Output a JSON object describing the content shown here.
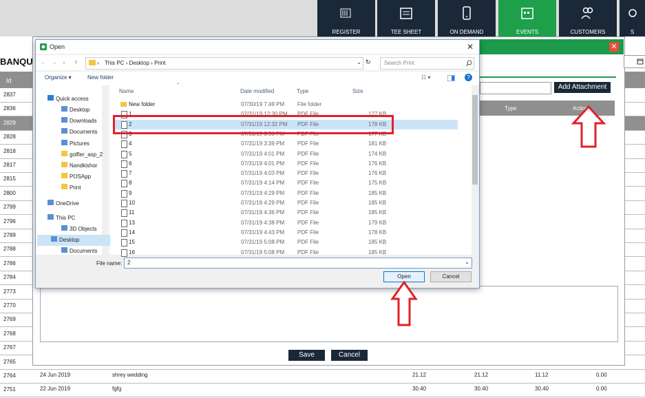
{
  "nav": [
    {
      "label": "REGISTER",
      "icon": "barcode-scanner-icon"
    },
    {
      "label": "TEE SHEET",
      "icon": "calendar-icon"
    },
    {
      "label": "ON DEMAND",
      "icon": "mobile-icon"
    },
    {
      "label": "EVENTS",
      "icon": "events-calendar-icon"
    },
    {
      "label": "CUSTOMERS",
      "icon": "users-icon"
    },
    {
      "label": "S",
      "icon": "settings-icon"
    }
  ],
  "page": {
    "title": "BANQUE",
    "id_header": "Id",
    "row_ids": [
      "2837",
      "2836",
      "2829",
      "2828",
      "2818",
      "2817",
      "2815",
      "2800",
      "2799",
      "2796",
      "2789",
      "2788",
      "2786",
      "2784",
      "2773",
      "2770",
      "2769",
      "2768",
      "2767",
      "2765",
      "2764",
      "2751"
    ],
    "selected_id": "2829",
    "bottom_rows": [
      {
        "id": "2764",
        "date": "24 Jun 2019",
        "name": "shrey wedding",
        "v1": "21.12",
        "v2": "21.12",
        "v3": "11.12",
        "v4": "0.00"
      },
      {
        "id": "2751",
        "date": "22 Jun 2019",
        "name": "fgfg",
        "v1": "30.40",
        "v2": "30.40",
        "v3": "30.40",
        "v4": "0.00"
      }
    ]
  },
  "modal": {
    "add_attachment": "Add Attachment",
    "type_header": "Type",
    "action_header": "Action",
    "save": "Save",
    "cancel": "Cancel",
    "close": "✕"
  },
  "dialog": {
    "title": "Open",
    "path": [
      "This PC",
      "Desktop",
      "Print"
    ],
    "search_placeholder": "Search Print",
    "organize": "Organize ▾",
    "new_folder": "New folder",
    "nav_items": [
      {
        "label": "Quick access",
        "icon": "star-icon"
      },
      {
        "label": "Desktop",
        "icon": "desktop-icon"
      },
      {
        "label": "Downloads",
        "icon": "download-icon"
      },
      {
        "label": "Documents",
        "icon": "document-icon"
      },
      {
        "label": "Pictures",
        "icon": "pictures-icon"
      },
      {
        "label": "golfler_asp_2",
        "icon": "folder-icon"
      },
      {
        "label": "Nandkishor",
        "icon": "folder-icon"
      },
      {
        "label": "POSApp",
        "icon": "folder-icon"
      },
      {
        "label": "Print",
        "icon": "folder-icon"
      },
      {
        "label": "OneDrive",
        "icon": "cloud-icon"
      },
      {
        "label": "This PC",
        "icon": "computer-icon"
      },
      {
        "label": "3D Objects",
        "icon": "cube-icon"
      },
      {
        "label": "Desktop",
        "icon": "desktop-icon"
      },
      {
        "label": "Documents",
        "icon": "document-icon"
      }
    ],
    "columns": [
      "Name",
      "Date modified",
      "Type",
      "Size"
    ],
    "files": [
      {
        "name": "New folder",
        "date": "07/30/19 7:49 PM",
        "type": "File folder",
        "size": ""
      },
      {
        "name": "1",
        "date": "07/31/19 12:30 PM",
        "type": "PDF File",
        "size": "177 KB"
      },
      {
        "name": "2",
        "date": "07/31/19 12:32 PM",
        "type": "PDF File",
        "size": "178 KB"
      },
      {
        "name": "3",
        "date": "07/31/19 3:50 PM",
        "type": "PDF File",
        "size": "177 KB"
      },
      {
        "name": "4",
        "date": "07/31/19 3:39 PM",
        "type": "PDF File",
        "size": "181 KB"
      },
      {
        "name": "5",
        "date": "07/31/19 4:01 PM",
        "type": "PDF File",
        "size": "174 KB"
      },
      {
        "name": "6",
        "date": "07/31/19 4:01 PM",
        "type": "PDF File",
        "size": "176 KB"
      },
      {
        "name": "7",
        "date": "07/31/19 4:03 PM",
        "type": "PDF File",
        "size": "176 KB"
      },
      {
        "name": "8",
        "date": "07/31/19 4:14 PM",
        "type": "PDF File",
        "size": "175 KB"
      },
      {
        "name": "9",
        "date": "07/31/19 4:29 PM",
        "type": "PDF File",
        "size": "185 KB"
      },
      {
        "name": "10",
        "date": "07/31/19 4:29 PM",
        "type": "PDF File",
        "size": "185 KB"
      },
      {
        "name": "11",
        "date": "07/31/19 4:36 PM",
        "type": "PDF File",
        "size": "185 KB"
      },
      {
        "name": "13",
        "date": "07/31/19 4:38 PM",
        "type": "PDF File",
        "size": "179 KB"
      },
      {
        "name": "14",
        "date": "07/31/19 4:43 PM",
        "type": "PDF File",
        "size": "178 KB"
      },
      {
        "name": "15",
        "date": "07/31/19 5:08 PM",
        "type": "PDF File",
        "size": "185 KB"
      },
      {
        "name": "16",
        "date": "07/31/19 5:08 PM",
        "type": "PDF File",
        "size": "185 KB"
      }
    ],
    "selected_file": "2",
    "file_name_label": "File name:",
    "file_name_value": "2",
    "open": "Open",
    "cancel": "Cancel"
  },
  "colors": {
    "nav_dark": "#1b2838",
    "accent_green": "#1ea04a",
    "highlight_red": "#e0202a"
  }
}
